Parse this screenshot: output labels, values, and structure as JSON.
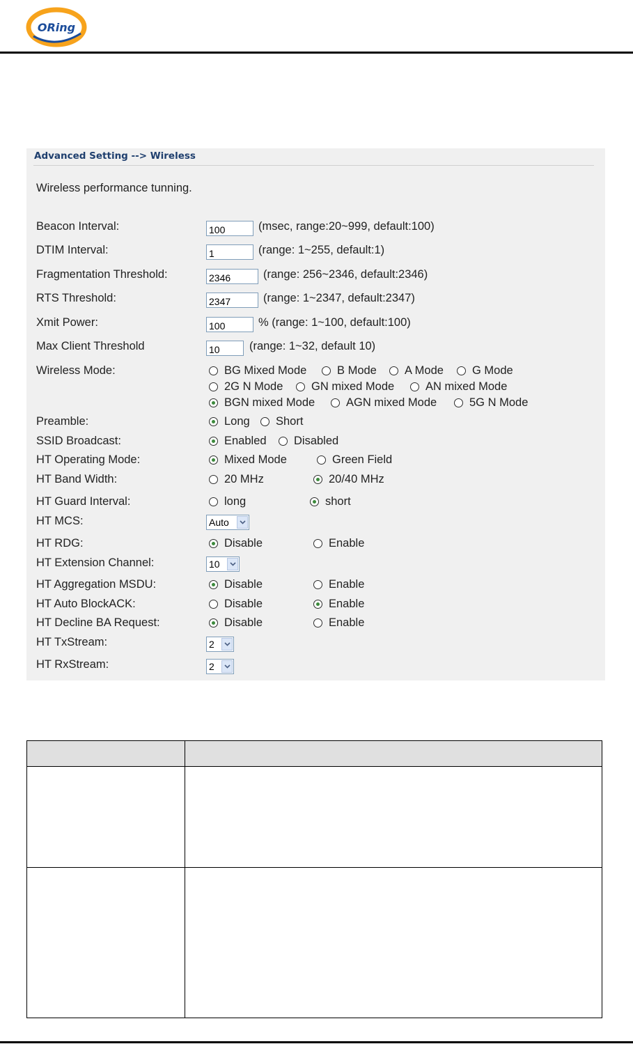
{
  "brand": {
    "logo_text": "ORing",
    "accent": "#f7a31c",
    "logo_blue": "#1b4c9a"
  },
  "breadcrumb": "Advanced Setting --> Wireless",
  "intro": "Wireless performance tunning.",
  "fields": {
    "beacon": {
      "label": "Beacon Interval:",
      "value": "100",
      "hint": "(msec, range:20~999, default:100)"
    },
    "dtim": {
      "label": "DTIM Interval:",
      "value": "1",
      "hint": "(range: 1~255, default:1)"
    },
    "frag": {
      "label": "Fragmentation Threshold:",
      "value": "2346",
      "hint": "(range: 256~2346, default:2346)"
    },
    "rts": {
      "label": "RTS Threshold:",
      "value": "2347",
      "hint": "(range: 1~2347, default:2347)"
    },
    "xmit": {
      "label": "Xmit Power:",
      "value": "100",
      "hint": "% (range: 1~100, default:100)"
    },
    "maxclient": {
      "label": "Max Client Threshold",
      "value": "10",
      "hint": "(range: 1~32, default 10)"
    }
  },
  "wireless_mode": {
    "label": "Wireless Mode:",
    "options": [
      "BG Mixed Mode",
      "B Mode",
      "A Mode",
      "G Mode",
      "2G N Mode",
      "GN mixed Mode",
      "AN mixed Mode",
      "BGN mixed Mode",
      "AGN mixed Mode",
      "5G N Mode"
    ],
    "selected": "BGN mixed Mode"
  },
  "preamble": {
    "label": "Preamble:",
    "opt1": "Long",
    "opt2": "Short",
    "selected": "Long"
  },
  "ssid": {
    "label": "SSID Broadcast:",
    "opt1": "Enabled",
    "opt2": "Disabled",
    "selected": "Enabled"
  },
  "ht_opmode": {
    "label": "HT Operating Mode:",
    "opt1": "Mixed Mode",
    "opt2": "Green Field",
    "selected": "Mixed Mode"
  },
  "ht_bw": {
    "label": "HT Band Width:",
    "opt1": "20 MHz",
    "opt2": "20/40 MHz",
    "selected": "20/40 MHz"
  },
  "ht_gi": {
    "label": "HT Guard Interval:",
    "opt1": "long",
    "opt2": "short",
    "selected": "short"
  },
  "ht_mcs": {
    "label": "HT MCS:",
    "value": "Auto"
  },
  "ht_rdg": {
    "label": "HT RDG:",
    "opt1": "Disable",
    "opt2": "Enable",
    "selected": "Disable"
  },
  "ht_ext": {
    "label": "HT Extension Channel:",
    "value": "10"
  },
  "ht_amsdu": {
    "label": "HT Aggregation MSDU:",
    "opt1": "Disable",
    "opt2": "Enable",
    "selected": "Disable"
  },
  "ht_autoba": {
    "label": "HT Auto BlockACK:",
    "opt1": "Disable",
    "opt2": "Enable",
    "selected": "Enable"
  },
  "ht_declineba": {
    "label": "HT Decline BA Request:",
    "opt1": "Disable",
    "opt2": "Enable",
    "selected": "Disable"
  },
  "ht_tx": {
    "label": "HT TxStream:",
    "value": "2"
  },
  "ht_rx": {
    "label": "HT RxStream:",
    "value": "2"
  }
}
